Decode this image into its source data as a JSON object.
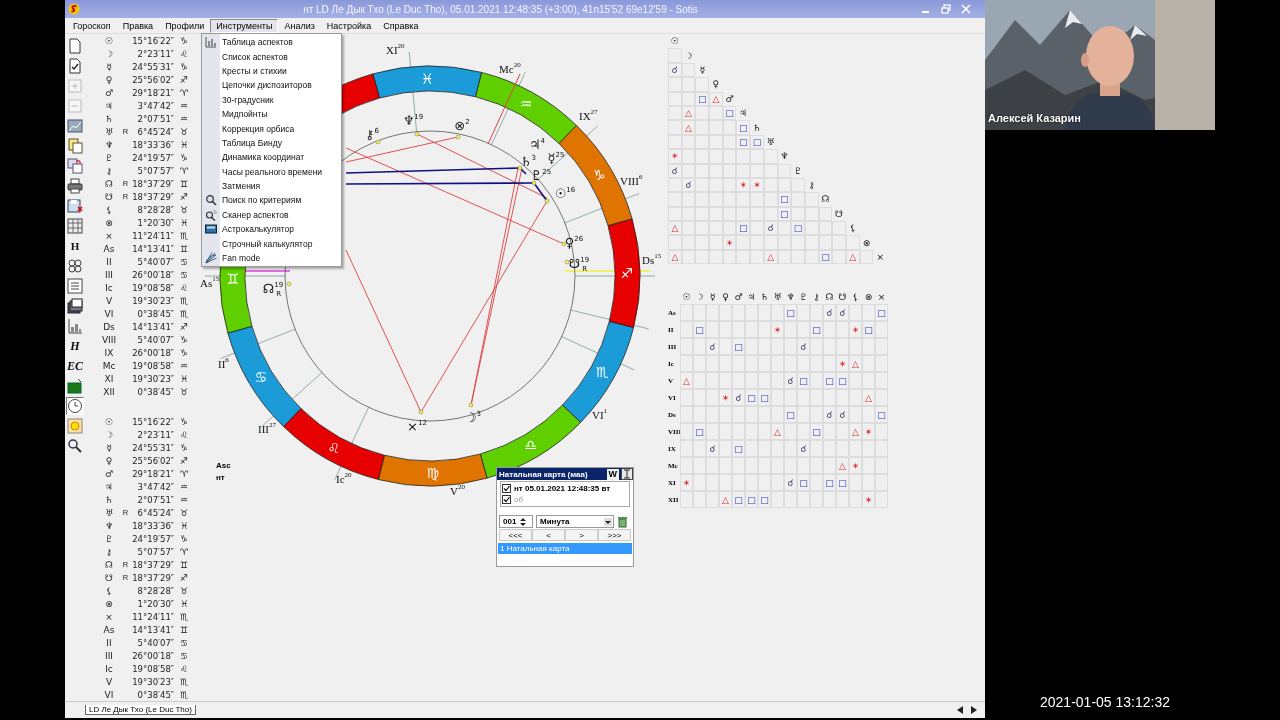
{
  "window": {
    "title": "нт LD Ле Дык Тхо (Le Duc Tho), 05.01.2021 12:48:35 (+3:00), 41n15'52 69e12'59 - Sotis"
  },
  "menu": [
    {
      "label": "Гороскоп",
      "selected": false
    },
    {
      "label": "Правка",
      "selected": false
    },
    {
      "label": "Профили",
      "selected": false
    },
    {
      "label": "Инструменты",
      "selected": true
    },
    {
      "label": "Анализ",
      "selected": false
    },
    {
      "label": "Настройка",
      "selected": false
    },
    {
      "label": "Справка",
      "selected": false
    }
  ],
  "dropdown": [
    {
      "label": "Таблица аспектов",
      "kind": "table"
    },
    {
      "label": "Список аспектов"
    },
    {
      "label": "Кресты и стихии"
    },
    {
      "label": "Цепочки диспозиторов"
    },
    {
      "label": "30-градусник"
    },
    {
      "label": "Мидпойнты"
    },
    {
      "label": "Коррекция орбиса"
    },
    {
      "label": "Таблица Бинду"
    },
    {
      "label": "Динамика координат"
    },
    {
      "label": "Часы реального времени"
    },
    {
      "label": "Затмения"
    },
    {
      "label": "Поиск по критериям",
      "kind": "search"
    },
    {
      "label": "Сканер аспектов",
      "kind": "scanner"
    },
    {
      "label": "Астрокалькулятор",
      "kind": "calculator"
    },
    {
      "label": "Строчный калькулятор"
    },
    {
      "label": "Fan mode",
      "kind": "fan"
    }
  ],
  "toolbar": [
    {
      "kind": "document",
      "disabled": false,
      "pressed": false
    },
    {
      "kind": "check",
      "disabled": false,
      "pressed": false
    },
    {
      "kind": "plus",
      "disabled": true,
      "pressed": false
    },
    {
      "kind": "minus",
      "disabled": true,
      "pressed": false
    },
    {
      "kind": "chart",
      "disabled": false,
      "pressed": false
    },
    {
      "kind": "pages",
      "disabled": false,
      "pressed": false
    },
    {
      "kind": "swap",
      "disabled": false,
      "pressed": false
    },
    {
      "kind": "print",
      "disabled": false,
      "pressed": false
    },
    {
      "kind": "save",
      "disabled": false,
      "pressed": false
    },
    {
      "kind": "grid",
      "disabled": false,
      "pressed": false
    },
    {
      "kind": "text",
      "label": "H",
      "disabled": false,
      "pressed": false
    },
    {
      "kind": "rings",
      "disabled": false,
      "pressed": false
    },
    {
      "kind": "list",
      "disabled": false,
      "pressed": false
    },
    {
      "kind": "stack",
      "disabled": false,
      "pressed": false
    },
    {
      "kind": "bars",
      "disabled": false,
      "pressed": false
    },
    {
      "kind": "script",
      "label": "H",
      "disabled": false,
      "pressed": false
    },
    {
      "kind": "script",
      "label": "EC",
      "disabled": false,
      "pressed": false
    },
    {
      "kind": "folder",
      "disabled": false,
      "pressed": false
    },
    {
      "kind": "clock",
      "disabled": false,
      "pressed": true
    },
    {
      "kind": "sun",
      "disabled": false,
      "pressed": false
    },
    {
      "kind": "search",
      "disabled": false,
      "pressed": false
    }
  ],
  "positions_1": [
    {
      "glyph": "☉",
      "deg": "15°16′22″",
      "sign": "♑"
    },
    {
      "glyph": "☽",
      "deg": "2°23′11″",
      "sign": "♌"
    },
    {
      "glyph": "☿",
      "deg": "24°55′31″",
      "sign": "♑"
    },
    {
      "glyph": "♀",
      "deg": "25°56′02″",
      "sign": "♐"
    },
    {
      "glyph": "♂",
      "deg": "29°18′21″",
      "sign": "♈"
    },
    {
      "glyph": "♃",
      "deg": "3°47′42″",
      "sign": "♒"
    },
    {
      "glyph": "♄",
      "deg": "2°07′51″",
      "sign": "♒"
    },
    {
      "glyph": "♅",
      "mark": "R",
      "deg": "6°45′24″",
      "sign": "♉"
    },
    {
      "glyph": "♆",
      "deg": "18°33′36″",
      "sign": "♓"
    },
    {
      "glyph": "♇",
      "deg": "24°19′57″",
      "sign": "♑"
    },
    {
      "glyph": "⚷",
      "deg": "5°07′57″",
      "sign": "♈"
    },
    {
      "glyph": "☊",
      "mark": "R",
      "deg": "18°37′29″",
      "sign": "♊"
    },
    {
      "glyph": "☋",
      "mark": "R",
      "deg": "18°37′29″",
      "sign": "♐"
    },
    {
      "glyph": "⚸",
      "deg": "8°28′28″",
      "sign": "♉"
    },
    {
      "glyph": "⊗",
      "deg": "1°20′30″",
      "sign": "♓"
    },
    {
      "glyph": "×",
      "deg": "11°24′11″",
      "sign": "♏"
    },
    {
      "glyph": "As",
      "deg": "14°13′41″",
      "sign": "♊"
    },
    {
      "glyph": "II",
      "deg": "5°40′07″",
      "sign": "♋"
    },
    {
      "glyph": "III",
      "deg": "26°00′18″",
      "sign": "♋"
    },
    {
      "glyph": "Ic",
      "deg": "19°08′58″",
      "sign": "♌"
    },
    {
      "glyph": "V",
      "deg": "19°30′23″",
      "sign": "♏"
    },
    {
      "glyph": "VI",
      "deg": "0°38′45″",
      "sign": "♏"
    },
    {
      "glyph": "Ds",
      "deg": "14°13′41″",
      "sign": "♐"
    },
    {
      "glyph": "VIII",
      "deg": "5°40′07″",
      "sign": "♑"
    },
    {
      "glyph": "IX",
      "deg": "26°00′18″",
      "sign": "♑"
    },
    {
      "glyph": "Mc",
      "deg": "19°08′58″",
      "sign": "♒"
    },
    {
      "glyph": "XI",
      "deg": "19°30′23″",
      "sign": "♓"
    },
    {
      "glyph": "XII",
      "deg": "0°38′45″",
      "sign": "♉"
    }
  ],
  "positions_2": [
    {
      "glyph": "☉",
      "deg": "15°16′22″",
      "sign": "♑"
    },
    {
      "glyph": "☽",
      "deg": "2°23′11″",
      "sign": "♌"
    },
    {
      "glyph": "☿",
      "deg": "24°55′31″",
      "sign": "♑"
    },
    {
      "glyph": "♀",
      "deg": "25°56′02″",
      "sign": "♐"
    },
    {
      "glyph": "♂",
      "deg": "29°18′21″",
      "sign": "♈"
    },
    {
      "glyph": "♃",
      "deg": "3°47′42″",
      "sign": "♒"
    },
    {
      "glyph": "♄",
      "deg": "2°07′51″",
      "sign": "♒"
    },
    {
      "glyph": "♅",
      "mark": "R",
      "deg": "6°45′24″",
      "sign": "♉"
    },
    {
      "glyph": "♆",
      "deg": "18°33′36″",
      "sign": "♓"
    },
    {
      "glyph": "♇",
      "deg": "24°19′57″",
      "sign": "♑"
    },
    {
      "glyph": "⚷",
      "deg": "5°07′57″",
      "sign": "♈"
    },
    {
      "glyph": "☊",
      "mark": "R",
      "deg": "18°37′29″",
      "sign": "♊"
    },
    {
      "glyph": "☋",
      "mark": "R",
      "deg": "18°37′29″",
      "sign": "♐"
    },
    {
      "glyph": "⚸",
      "deg": "8°28′28″",
      "sign": "♉"
    },
    {
      "glyph": "⊗",
      "deg": "1°20′30″",
      "sign": "♓"
    },
    {
      "glyph": "×",
      "deg": "11°24′11″",
      "sign": "♏"
    },
    {
      "glyph": "As",
      "deg": "14°13′41″",
      "sign": "♊"
    },
    {
      "glyph": "II",
      "deg": "5°40′07″",
      "sign": "♋"
    },
    {
      "glyph": "III",
      "deg": "26°00′18″",
      "sign": "♋"
    },
    {
      "glyph": "Ic",
      "deg": "19°08′58″",
      "sign": "♌"
    },
    {
      "glyph": "V",
      "deg": "19°30′23″",
      "sign": "♏"
    },
    {
      "glyph": "VI",
      "deg": "0°38′45″",
      "sign": "♏"
    }
  ],
  "wheel": {
    "signs": [
      {
        "glyph": "♊",
        "color": "#5fcf00"
      },
      {
        "glyph": "♋",
        "color": "#1b9bd8"
      },
      {
        "glyph": "♌",
        "color": "#e60000"
      },
      {
        "glyph": "♍",
        "color": "#e07400"
      },
      {
        "glyph": "♎",
        "color": "#5fcf00"
      },
      {
        "glyph": "♏",
        "color": "#1b9bd8"
      },
      {
        "glyph": "♐",
        "color": "#e60000"
      },
      {
        "glyph": "♑",
        "color": "#e07400"
      },
      {
        "glyph": "♒",
        "color": "#5fcf00"
      },
      {
        "glyph": "♓",
        "color": "#1b9bd8"
      },
      {
        "color": "#e60000"
      }
    ],
    "planets": [
      {
        "glyph": "♆",
        "degree": "19"
      },
      {
        "glyph": "⊗",
        "degree": "2"
      },
      {
        "glyph": "⚷",
        "degree": "6"
      },
      {
        "glyph": "♃",
        "degree": "4"
      },
      {
        "glyph": "♄",
        "degree": "3"
      },
      {
        "glyph": "☿",
        "degree": "25"
      },
      {
        "glyph": "♇",
        "degree": "25"
      },
      {
        "glyph": "☉",
        "degree": "16"
      },
      {
        "glyph": "♀",
        "degree": "26"
      },
      {
        "glyph": "☋",
        "degree": "19",
        "mark": "R"
      },
      {
        "glyph": "☊",
        "degree": "19",
        "mark": "R"
      },
      {
        "glyph": "×",
        "degree": "12"
      },
      {
        "glyph": "☽",
        "degree": "3"
      }
    ],
    "houses": [
      {
        "label": "XI",
        "degree": "20"
      },
      {
        "label": "Mc",
        "degree": "20"
      },
      {
        "label": "IX",
        "degree": "27"
      },
      {
        "label": "VIII",
        "degree": "6"
      },
      {
        "label": "Ds",
        "degree": "15"
      },
      {
        "label": "VI",
        "degree": "1"
      },
      {
        "label": "V",
        "degree": "20"
      },
      {
        "label": "Ic",
        "degree": "20"
      },
      {
        "label": "III",
        "degree": "27"
      },
      {
        "label": "II",
        "degree": "6"
      },
      {
        "label": "As",
        "degree": "15"
      }
    ],
    "notes": [
      "Asc",
      "нт"
    ]
  },
  "aspect_triangle": [
    {
      "glyph": "☉"
    },
    {
      "glyph": "☽",
      "cells": [
        null
      ]
    },
    {
      "glyph": "☿",
      "cells": [
        {
          "kind": "conjunction",
          "symbol": "☌"
        },
        null
      ]
    },
    {
      "glyph": "♀",
      "cells": [
        null,
        null,
        null
      ]
    },
    {
      "glyph": "♂",
      "cells": [
        null,
        null,
        {
          "kind": "square",
          "symbol": "□"
        },
        {
          "kind": "trine",
          "symbol": "△"
        }
      ]
    },
    {
      "glyph": "♃",
      "cells": [
        null,
        {
          "kind": "trine",
          "symbol": "△"
        },
        null,
        null,
        {
          "kind": "square",
          "symbol": "□"
        }
      ]
    },
    {
      "glyph": "♄",
      "cells": [
        null,
        {
          "kind": "trine",
          "symbol": "△"
        },
        null,
        null,
        null,
        {
          "kind": "square",
          "symbol": "□"
        }
      ]
    },
    {
      "glyph": "♅",
      "cells": [
        null,
        null,
        null,
        null,
        null,
        {
          "kind": "square",
          "symbol": "□"
        },
        {
          "kind": "square",
          "symbol": "□"
        }
      ]
    },
    {
      "glyph": "♆",
      "cells": [
        {
          "kind": "sextile",
          "symbol": "✶"
        },
        null,
        null,
        null,
        null,
        null,
        null,
        null
      ]
    },
    {
      "glyph": "♇",
      "cells": [
        {
          "kind": "conjunction",
          "symbol": "☌"
        },
        null,
        null,
        null,
        null,
        null,
        null,
        null,
        null
      ]
    },
    {
      "glyph": "⚷",
      "cells": [
        null,
        {
          "kind": "conjunction",
          "symbol": "☌"
        },
        null,
        null,
        null,
        {
          "kind": "sextile",
          "symbol": "✶"
        },
        {
          "kind": "sextile",
          "symbol": "✶"
        },
        null,
        null,
        null
      ]
    },
    {
      "glyph": "☊",
      "cells": [
        null,
        null,
        null,
        null,
        null,
        null,
        null,
        null,
        {
          "kind": "square",
          "symbol": "□"
        },
        null,
        null
      ]
    },
    {
      "glyph": "☋",
      "cells": [
        null,
        null,
        null,
        null,
        null,
        null,
        null,
        null,
        {
          "kind": "square",
          "symbol": "□"
        },
        null,
        null,
        null
      ]
    },
    {
      "glyph": "⚸",
      "cells": [
        {
          "kind": "trine",
          "symbol": "△"
        },
        null,
        null,
        null,
        null,
        {
          "kind": "square",
          "symbol": "□"
        },
        null,
        {
          "kind": "conjunction",
          "symbol": "☌"
        },
        null,
        {
          "kind": "square",
          "symbol": "□"
        },
        null,
        null,
        null
      ]
    },
    {
      "glyph": "⊗",
      "cells": [
        null,
        null,
        null,
        null,
        {
          "kind": "sextile",
          "symbol": "✶"
        },
        null,
        null,
        null,
        null,
        null,
        null,
        null,
        null,
        null
      ]
    },
    {
      "glyph": "×",
      "cells": [
        {
          "kind": "trine",
          "symbol": "△"
        },
        null,
        null,
        null,
        null,
        null,
        null,
        {
          "kind": "trine",
          "symbol": "△"
        },
        null,
        null,
        null,
        {
          "kind": "square",
          "symbol": "□"
        },
        null,
        {
          "kind": "trine",
          "symbol": "△"
        },
        null
      ]
    }
  ],
  "aspect_grid": {
    "columns": [
      "☉",
      "☽",
      "☿",
      "♀",
      "♂",
      "♃",
      "♄",
      "♅",
      "♆",
      "♇",
      "⚷",
      "☊",
      "☋",
      "⚸",
      "⊗",
      "×"
    ],
    "rows": [
      {
        "label": "As",
        "cells": [
          null,
          null,
          null,
          null,
          null,
          null,
          null,
          null,
          {
            "kind": "square",
            "symbol": "□"
          },
          null,
          null,
          {
            "kind": "conjunction",
            "symbol": "☌"
          },
          {
            "kind": "conjunction",
            "symbol": "☌"
          },
          null,
          null,
          {
            "kind": "square",
            "symbol": "□"
          }
        ]
      },
      {
        "label": "II",
        "cells": [
          null,
          {
            "kind": "square",
            "symbol": "□"
          },
          null,
          null,
          null,
          null,
          null,
          {
            "kind": "sextile",
            "symbol": "✶"
          },
          null,
          null,
          {
            "kind": "square",
            "symbol": "□"
          },
          null,
          null,
          {
            "kind": "sextile",
            "symbol": "✶"
          },
          {
            "kind": "square",
            "symbol": "□"
          },
          null
        ]
      },
      {
        "label": "III",
        "cells": [
          null,
          null,
          {
            "kind": "conjunction",
            "symbol": "☌"
          },
          null,
          {
            "kind": "square",
            "symbol": "□"
          },
          null,
          null,
          null,
          null,
          {
            "kind": "conjunction",
            "symbol": "☌"
          },
          null,
          null,
          null,
          null,
          null,
          null
        ]
      },
      {
        "label": "Ic",
        "cells": [
          null,
          null,
          null,
          null,
          null,
          null,
          null,
          null,
          null,
          null,
          null,
          null,
          {
            "kind": "sextile",
            "symbol": "✶"
          },
          {
            "kind": "trine",
            "symbol": "△"
          },
          null,
          null
        ]
      },
      {
        "label": "V",
        "cells": [
          {
            "kind": "trine",
            "symbol": "△"
          },
          null,
          null,
          null,
          null,
          null,
          null,
          null,
          {
            "kind": "conjunction",
            "symbol": "☌"
          },
          {
            "kind": "square",
            "symbol": "□"
          },
          null,
          {
            "kind": "square",
            "symbol": "□"
          },
          {
            "kind": "square",
            "symbol": "□"
          },
          null,
          null,
          null
        ]
      },
      {
        "label": "VI",
        "cells": [
          null,
          null,
          null,
          {
            "kind": "sextile",
            "symbol": "✶"
          },
          {
            "kind": "conjunction",
            "symbol": "☌"
          },
          {
            "kind": "square",
            "symbol": "□"
          },
          {
            "kind": "square",
            "symbol": "□"
          },
          null,
          null,
          null,
          null,
          null,
          null,
          null,
          {
            "kind": "trine",
            "symbol": "△"
          },
          null
        ]
      },
      {
        "label": "Ds",
        "cells": [
          null,
          null,
          null,
          null,
          null,
          null,
          null,
          null,
          {
            "kind": "square",
            "symbol": "□"
          },
          null,
          null,
          {
            "kind": "conjunction",
            "symbol": "☌"
          },
          {
            "kind": "conjunction",
            "symbol": "☌"
          },
          null,
          null,
          {
            "kind": "square",
            "symbol": "□"
          }
        ]
      },
      {
        "label": "VIII",
        "cells": [
          null,
          {
            "kind": "square",
            "symbol": "□"
          },
          null,
          null,
          null,
          null,
          null,
          {
            "kind": "trine",
            "symbol": "△"
          },
          null,
          null,
          {
            "kind": "square",
            "symbol": "□"
          },
          null,
          null,
          {
            "kind": "trine",
            "symbol": "△"
          },
          {
            "kind": "sextile",
            "symbol": "✶"
          },
          null
        ]
      },
      {
        "label": "IX",
        "cells": [
          null,
          null,
          {
            "kind": "conjunction",
            "symbol": "☌"
          },
          null,
          {
            "kind": "square",
            "symbol": "□"
          },
          null,
          null,
          null,
          null,
          {
            "kind": "conjunction",
            "symbol": "☌"
          },
          null,
          null,
          null,
          null,
          null,
          null
        ]
      },
      {
        "label": "Mc",
        "cells": [
          null,
          null,
          null,
          null,
          null,
          null,
          null,
          null,
          null,
          null,
          null,
          null,
          {
            "kind": "trine",
            "symbol": "△"
          },
          {
            "kind": "sextile",
            "symbol": "✶"
          },
          null,
          null
        ]
      },
      {
        "label": "XI",
        "cells": [
          {
            "kind": "sextile",
            "symbol": "✶"
          },
          null,
          null,
          null,
          null,
          null,
          null,
          null,
          {
            "kind": "conjunction",
            "symbol": "☌"
          },
          {
            "kind": "square",
            "symbol": "□"
          },
          null,
          {
            "kind": "square",
            "symbol": "□"
          },
          {
            "kind": "square",
            "symbol": "□"
          },
          null,
          null,
          null
        ]
      },
      {
        "label": "XII",
        "cells": [
          null,
          null,
          null,
          {
            "kind": "trine",
            "symbol": "△"
          },
          {
            "kind": "square",
            "symbol": "□"
          },
          {
            "kind": "square",
            "symbol": "□"
          },
          {
            "kind": "square",
            "symbol": "□"
          },
          null,
          null,
          null,
          null,
          null,
          null,
          null,
          {
            "kind": "sextile",
            "symbol": "✶"
          },
          null
        ]
      }
    ]
  },
  "chart_panel": {
    "title": "Натальная карта (маа)",
    "title_button": "W",
    "entries": [
      {
        "label": "нт 05.01.2021 12:48:35 вт",
        "checked": true,
        "dimmed": false
      },
      {
        "label": "об",
        "checked": true,
        "dimmed": true
      }
    ],
    "step": "001",
    "unit": "Минута",
    "nav": [
      "<<<",
      "<",
      ">",
      ">>>"
    ],
    "list": [
      {
        "label": "1 Натальная карта",
        "selected": true
      }
    ]
  },
  "document_tab": "LD Ле Дык Тхо (Le Duc Tho)",
  "video": {
    "name": "Алексей Казарин"
  },
  "timestamp": "2021-01-05 13:12:32"
}
